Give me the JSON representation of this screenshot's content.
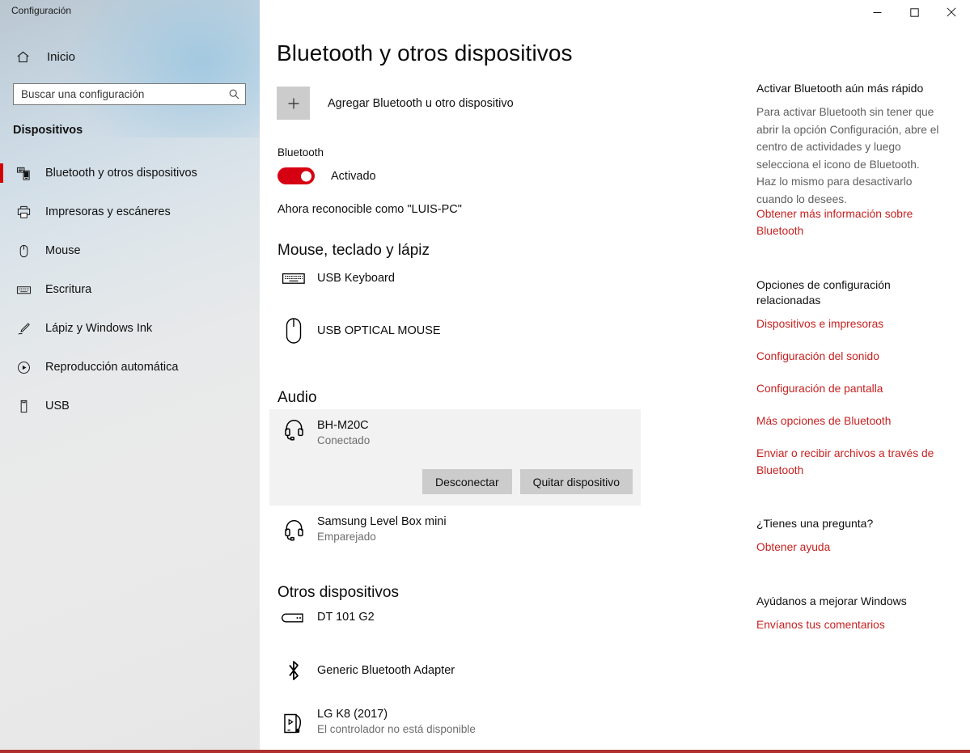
{
  "window": {
    "title": "Configuración",
    "controls": {
      "minimize": "minimize-icon",
      "maximize": "maximize-icon",
      "close": "close-icon"
    }
  },
  "sidebar": {
    "home_label": "Inicio",
    "home_icon": "home-icon",
    "search": {
      "placeholder": "Buscar una configuración",
      "value": "",
      "icon": "search-icon"
    },
    "section_header": "Dispositivos",
    "items": [
      {
        "label": "Bluetooth y otros dispositivos",
        "icon": "bluetooth-devices-icon",
        "active": true
      },
      {
        "label": "Impresoras y escáneres",
        "icon": "printer-icon",
        "active": false
      },
      {
        "label": "Mouse",
        "icon": "mouse-icon",
        "active": false
      },
      {
        "label": "Escritura",
        "icon": "keyboard-icon",
        "active": false
      },
      {
        "label": "Lápiz y Windows Ink",
        "icon": "pen-icon",
        "active": false
      },
      {
        "label": "Reproducción automática",
        "icon": "autoplay-icon",
        "active": false
      },
      {
        "label": "USB",
        "icon": "usb-icon",
        "active": false
      }
    ]
  },
  "main": {
    "page_title": "Bluetooth y otros dispositivos",
    "add_device": {
      "label": "Agregar Bluetooth u otro dispositivo",
      "icon": "plus-icon"
    },
    "bluetooth": {
      "label": "Bluetooth",
      "toggle_state": "Activado",
      "toggle_on": true,
      "discoverable_text": "Ahora reconocible como \"LUIS-PC\""
    },
    "groups": [
      {
        "title": "Mouse, teclado y lápiz",
        "devices": [
          {
            "name": "USB Keyboard",
            "status": "",
            "icon": "keyboard-icon"
          },
          {
            "name": "USB OPTICAL MOUSE",
            "status": "",
            "icon": "mouse-icon"
          }
        ]
      },
      {
        "title": "Audio",
        "devices": [
          {
            "name": "BH-M20C",
            "status": "Conectado",
            "icon": "headset-icon",
            "selected": true
          },
          {
            "name": "Samsung Level Box mini",
            "status": "Emparejado",
            "icon": "headset-icon",
            "selected": false
          }
        ]
      },
      {
        "title": "Otros dispositivos",
        "devices": [
          {
            "name": "DT 101 G2",
            "status": "",
            "icon": "usb-drive-icon"
          },
          {
            "name": "Generic Bluetooth Adapter",
            "status": "",
            "icon": "bluetooth-icon"
          },
          {
            "name": "LG K8 (2017)",
            "status": "El controlador no está disponible",
            "icon": "phone-icon"
          }
        ]
      }
    ],
    "selected_device_actions": {
      "disconnect": "Desconectar",
      "remove": "Quitar dispositivo"
    }
  },
  "right_panel": {
    "tip_title": "Activar Bluetooth aún más rápido",
    "tip_body": "Para activar Bluetooth sin tener que abrir la opción Configuración, abre el centro de actividades y luego selecciona el icono de Bluetooth. Haz lo mismo para desactivarlo cuando lo desees.",
    "tip_link": "Obtener más información sobre Bluetooth",
    "related_title": "Opciones de configuración relacionadas",
    "related_links": [
      "Dispositivos e impresoras",
      "Configuración del sonido",
      "Configuración de pantalla",
      "Más opciones de Bluetooth",
      "Enviar o recibir archivos a través de Bluetooth"
    ],
    "question_title": "¿Tienes una pregunta?",
    "question_link": "Obtener ayuda",
    "feedback_title": "Ayúdanos a mejorar Windows",
    "feedback_link": "Envíanos tus comentarios"
  },
  "colors": {
    "accent_red": "#d60000",
    "link_red": "#c62121",
    "card_bg": "#f2f2f2",
    "button_gray": "#cccccc"
  }
}
